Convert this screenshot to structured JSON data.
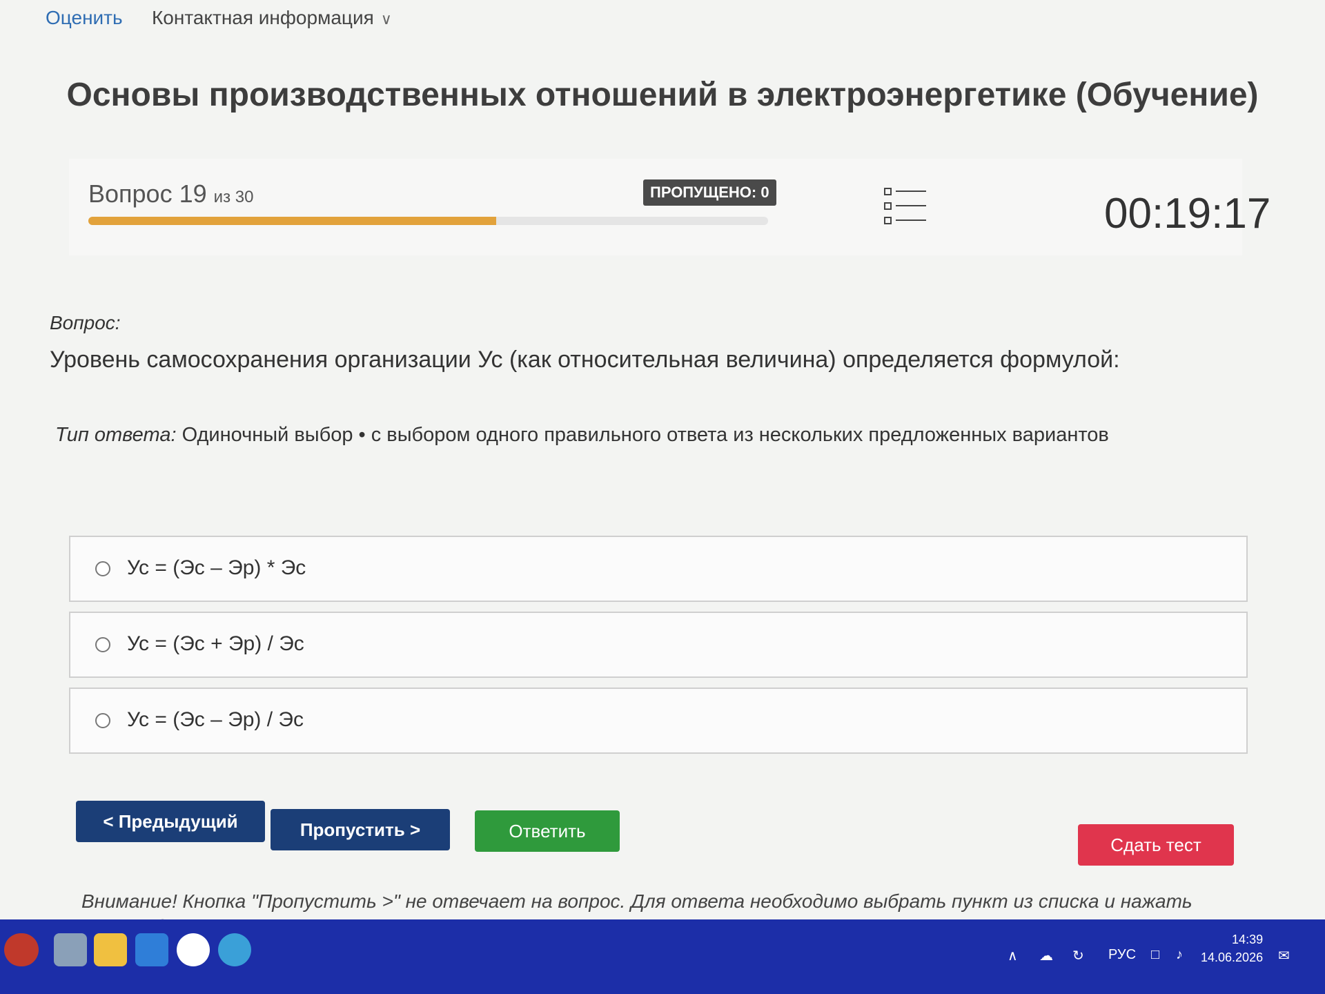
{
  "nav": {
    "rate": "Оценить",
    "contact": "Контактная информация"
  },
  "title": "Основы производственных отношений в электроэнергетике (Обучение)",
  "status": {
    "question_word": "Вопрос",
    "current": "19",
    "of_text": "из 30",
    "skipped": "ПРОПУЩЕНО: 0",
    "progress_fraction": 0.6,
    "timer": "00:19:17"
  },
  "question": {
    "label": "Вопрос:",
    "text": "Уровень самосохранения организации Ус (как относительная величина) определяется формулой:"
  },
  "answer_type": {
    "label": "Тип ответа:",
    "value": "Одиночный выбор • с выбором одного правильного ответа из нескольких предложенных вариантов"
  },
  "options": [
    "Ус = (Эс – Эр) * Эс",
    "Ус = (Эс + Эр) / Эс",
    "Ус = (Эс – Эр) / Эс"
  ],
  "buttons": {
    "prev": "< Предыдущий",
    "skip": "Пропустить >",
    "answer": "Ответить",
    "submit": "Сдать тест"
  },
  "warning": "Внимание! Кнопка \"Пропустить >\" не отвечает на вопрос. Для ответа необходимо выбрать пункт из списка и нажать кнопку \"Ответить\"",
  "taskbar": {
    "lang": "РУС",
    "time": "14:39",
    "date": "14.06.2026"
  },
  "colors": {
    "accent_blue": "#1b3e77",
    "answer_green": "#2f9a3c",
    "submit_red": "#e0354d",
    "progress_orange": "#e2a23b",
    "taskbar": "#1c2ea8"
  }
}
